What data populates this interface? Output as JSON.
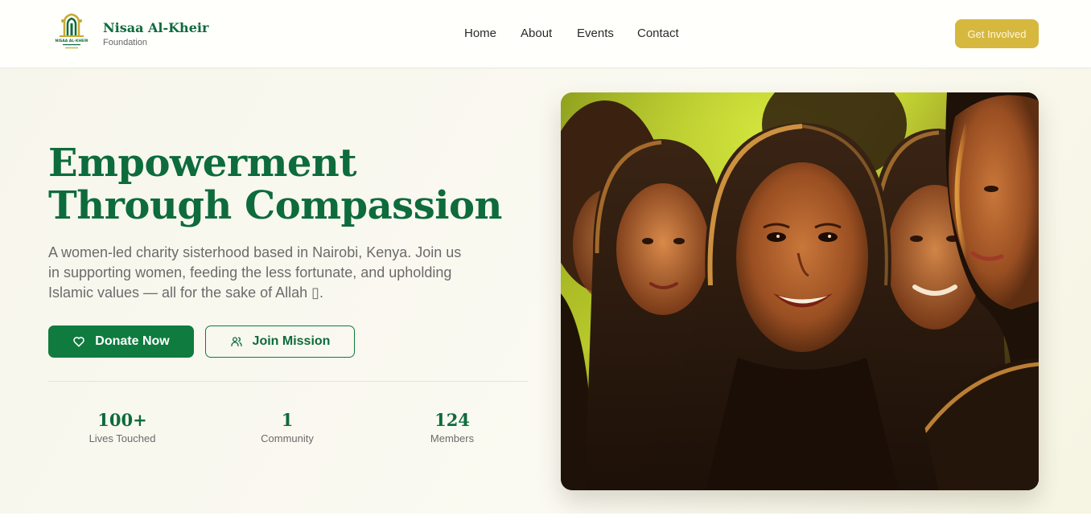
{
  "brand": {
    "name": "Nisaa Al-Kheir",
    "tagline": "Foundation",
    "logo_text": "NISAA AL-KHEIR"
  },
  "nav": {
    "links": [
      "Home",
      "About",
      "Events",
      "Contact"
    ],
    "cta_label": "Get Involved"
  },
  "hero": {
    "headline_line1": "Empowerment",
    "headline_line2": "Through Compassion",
    "subtext": "A women-led charity sisterhood based in Nairobi, Kenya. Join us in supporting women, feeding the less fortunate, and upholding Islamic values — all for the sake of Allah ▯.",
    "donate_label": "Donate Now",
    "join_label": "Join Mission",
    "photo_alt": "Smiling girls wearing hijabs"
  },
  "stats": [
    {
      "value": "100+",
      "label": "Lives Touched"
    },
    {
      "value": "1",
      "label": "Community"
    },
    {
      "value": "124",
      "label": "Members"
    }
  ],
  "colors": {
    "brand_green": "#0d6b3c",
    "button_green": "#0f7b3f",
    "gold": "#d6b83f",
    "background": "#faf9f2"
  },
  "icons": {
    "donate": "heart-icon",
    "join": "users-icon"
  }
}
